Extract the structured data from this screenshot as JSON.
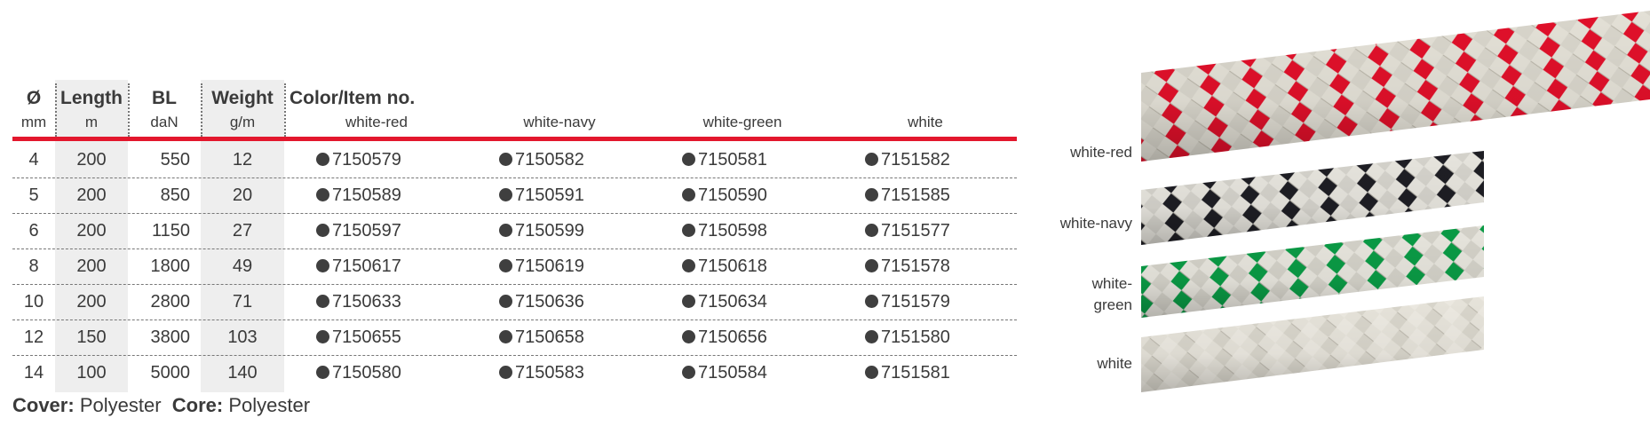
{
  "table": {
    "columns": [
      {
        "title": "Ø",
        "unit": "mm"
      },
      {
        "title": "Length",
        "unit": "m"
      },
      {
        "title": "BL",
        "unit": "daN"
      },
      {
        "title": "Weight",
        "unit": "g/m"
      },
      {
        "title": "Color/Item no.",
        "unit": ""
      }
    ],
    "colors": [
      "white-red",
      "white-navy",
      "white-green",
      "white"
    ],
    "rows": [
      {
        "d": "4",
        "length": "200",
        "bl": "550",
        "weight": "12",
        "items": [
          "7150579",
          "7150582",
          "7150581",
          "7151582"
        ]
      },
      {
        "d": "5",
        "length": "200",
        "bl": "850",
        "weight": "20",
        "items": [
          "7150589",
          "7150591",
          "7150590",
          "7151585"
        ]
      },
      {
        "d": "6",
        "length": "200",
        "bl": "1150",
        "weight": "27",
        "items": [
          "7150597",
          "7150599",
          "7150598",
          "7151577"
        ]
      },
      {
        "d": "8",
        "length": "200",
        "bl": "1800",
        "weight": "49",
        "items": [
          "7150617",
          "7150619",
          "7150618",
          "7151578"
        ]
      },
      {
        "d": "10",
        "length": "200",
        "bl": "2800",
        "weight": "71",
        "items": [
          "7150633",
          "7150636",
          "7150634",
          "7151579"
        ]
      },
      {
        "d": "12",
        "length": "150",
        "bl": "3800",
        "weight": "103",
        "items": [
          "7150655",
          "7150658",
          "7150656",
          "7151580"
        ]
      },
      {
        "d": "14",
        "length": "100",
        "bl": "5000",
        "weight": "140",
        "items": [
          "7150580",
          "7150583",
          "7150584",
          "7151581"
        ]
      }
    ]
  },
  "footer": {
    "cover_label": "Cover:",
    "cover_value": "Polyester",
    "core_label": "Core:",
    "core_value": "Polyester"
  },
  "rope_labels": [
    "white-red",
    "white-navy",
    "white-",
    "green",
    "white"
  ],
  "colors_hex": {
    "accent_red": "#e3172d",
    "rope_red": "#e0102a",
    "rope_navy": "#1e1e24",
    "rope_green": "#0a9a45",
    "rope_white": "#e6e3da",
    "dot": "#3f3f3f"
  }
}
